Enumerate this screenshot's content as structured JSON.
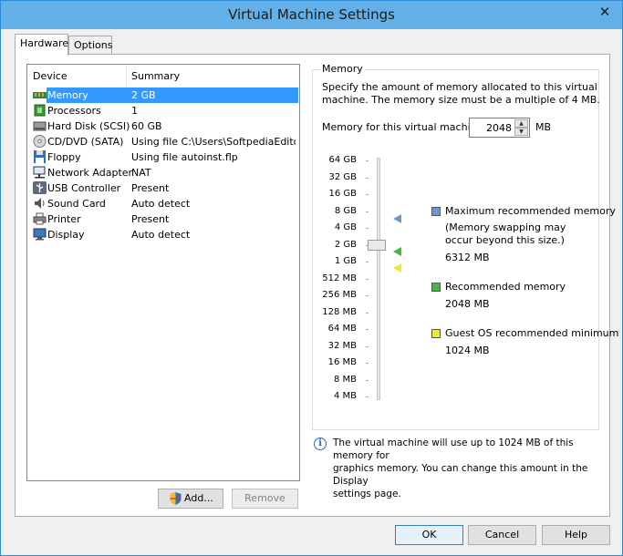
{
  "window": {
    "title": "Virtual Machine Settings",
    "close_glyph": "✕"
  },
  "tabs": [
    {
      "label": "Hardware"
    },
    {
      "label": "Options"
    }
  ],
  "device_list": {
    "headers": {
      "device": "Device",
      "summary": "Summary"
    },
    "rows": [
      {
        "name": "Memory",
        "summary": "2 GB",
        "icon": "memory-icon"
      },
      {
        "name": "Processors",
        "summary": "1",
        "icon": "processor-icon"
      },
      {
        "name": "Hard Disk (SCSI)",
        "summary": "60 GB",
        "icon": "hard-disk-icon"
      },
      {
        "name": "CD/DVD (SATA)",
        "summary": "Using file C:\\Users\\SoftpediaEdito...",
        "icon": "cd-dvd-icon"
      },
      {
        "name": "Floppy",
        "summary": "Using file autoinst.flp",
        "icon": "floppy-icon"
      },
      {
        "name": "Network Adapter",
        "summary": "NAT",
        "icon": "network-adapter-icon"
      },
      {
        "name": "USB Controller",
        "summary": "Present",
        "icon": "usb-icon"
      },
      {
        "name": "Sound Card",
        "summary": "Auto detect",
        "icon": "sound-card-icon"
      },
      {
        "name": "Printer",
        "summary": "Present",
        "icon": "printer-icon"
      },
      {
        "name": "Display",
        "summary": "Auto detect",
        "icon": "display-icon"
      }
    ],
    "selected": "Memory"
  },
  "buttons": {
    "add": "Add...",
    "remove": "Remove",
    "ok": "OK",
    "cancel": "Cancel",
    "help": "Help"
  },
  "memory": {
    "group_title": "Memory",
    "description_line1": "Specify the amount of memory allocated to this virtual",
    "description_line2": "machine. The memory size must be a multiple of 4 MB.",
    "field_label": "Memory for this virtual machine:",
    "value": "2048",
    "unit": "MB",
    "scale": [
      "64 GB",
      "32 GB",
      "16 GB",
      "8 GB",
      "4 GB",
      "2 GB",
      "1 GB",
      "512 MB",
      "256 MB",
      "128 MB",
      "64 MB",
      "32 MB",
      "16 MB",
      "8 MB",
      "4 MB"
    ],
    "legend": {
      "max_label": "Maximum recommended memory",
      "max_note_line1": "(Memory swapping may",
      "max_note_line2": "occur beyond this size.)",
      "max_value": "6312 MB",
      "rec_label": "Recommended memory",
      "rec_value": "2048 MB",
      "min_label": "Guest OS recommended minimum",
      "min_value": "1024 MB"
    },
    "colors": {
      "max": "#6f97c9",
      "recommended": "#44b844",
      "minimum": "#f2e63a"
    }
  },
  "info": {
    "line1": "The virtual machine will use up to 1024 MB of this memory for",
    "line2": "graphics memory. You can change this amount in the Display",
    "line3": "settings page."
  }
}
